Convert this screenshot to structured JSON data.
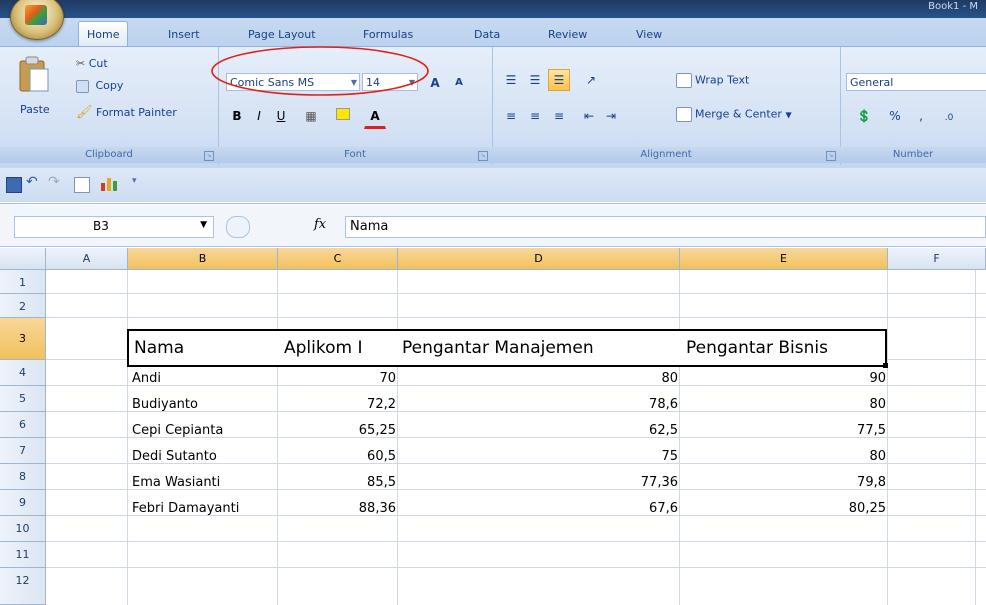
{
  "window": {
    "title_fragment": "Book1 - M"
  },
  "tabs": [
    {
      "label": "Home",
      "active": true
    },
    {
      "label": "Insert"
    },
    {
      "label": "Page Layout"
    },
    {
      "label": "Formulas"
    },
    {
      "label": "Data"
    },
    {
      "label": "Review"
    },
    {
      "label": "View"
    }
  ],
  "clipboard": {
    "paste": "Paste",
    "cut": "Cut",
    "copy": "Copy",
    "format_painter": "Format Painter",
    "label": "Clipboard"
  },
  "font": {
    "name": "Comic Sans MS",
    "size": "14",
    "label": "Font",
    "bold": "B",
    "italic": "I",
    "underline": "U",
    "grow": "A",
    "shrink": "A",
    "font_color": "A"
  },
  "alignment": {
    "wrap_text": "Wrap Text",
    "merge_center": "Merge & Center",
    "label": "Alignment"
  },
  "number": {
    "format": "General",
    "percent": "%",
    "comma": ",",
    "label": "Number"
  },
  "formula_bar": {
    "name_box": "B3",
    "fx": "fx",
    "content": "Nama"
  },
  "columns": [
    "A",
    "B",
    "C",
    "D",
    "E",
    "F"
  ],
  "rows": [
    "1",
    "2",
    "3",
    "4",
    "5",
    "6",
    "7",
    "8",
    "9",
    "10",
    "11",
    "12"
  ],
  "table": {
    "headers": [
      "Nama",
      "Aplikom I",
      "Pengantar Manajemen",
      "Pengantar Bisnis"
    ],
    "rows": [
      [
        "Andi",
        "70",
        "80",
        "90"
      ],
      [
        "Budiyanto",
        "72,2",
        "78,6",
        "80"
      ],
      [
        "Cepi Cepianta",
        "65,25",
        "62,5",
        "77,5"
      ],
      [
        "Dedi Sutanto",
        "60,5",
        "75",
        "80"
      ],
      [
        "Ema Wasianti",
        "85,5",
        "77,36",
        "79,8"
      ],
      [
        "Febri Damayanti",
        "88,36",
        "67,6",
        "80,25"
      ]
    ]
  },
  "annotation": {
    "color": "#e0201a"
  },
  "colors": {
    "selected_header": "#f1c15b",
    "ribbon": "#d3e1f4",
    "accent": "#15428b"
  }
}
